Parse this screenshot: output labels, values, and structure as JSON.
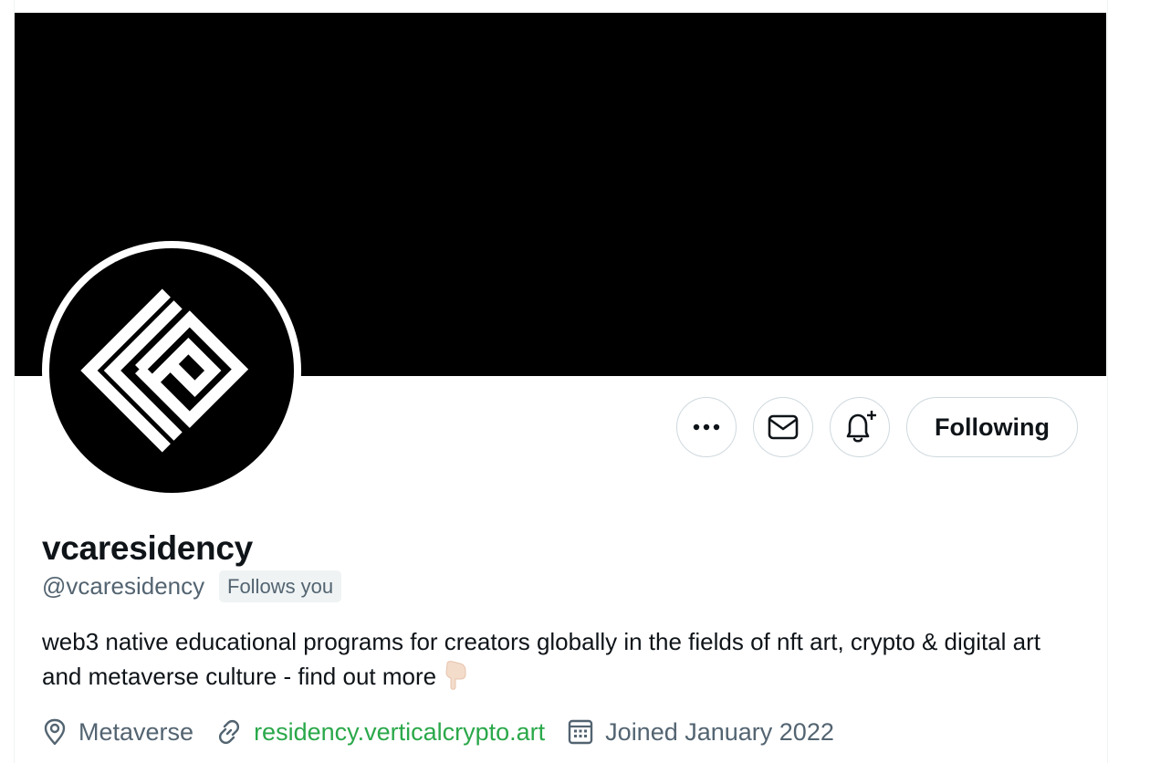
{
  "profile": {
    "display_name": "vcaresidency",
    "handle": "@vcaresidency",
    "follows_badge": "Follows you",
    "bio_text": "web3 native educational programs for creators globally in the fields of nft art, crypto & digital art and metaverse culture - find out more",
    "bio_emoji_icon": "pointing-down-hand-icon",
    "location": "Metaverse",
    "website": "residency.verticalcrypto.art",
    "joined": "Joined January 2022"
  },
  "actions": {
    "following_label": "Following",
    "more_icon": "more-dots-icon",
    "message_icon": "envelope-icon",
    "notifications_icon": "bell-plus-icon"
  },
  "colors": {
    "banner": "#000000",
    "link": "#2aa84a",
    "secondary_text": "#536471",
    "primary_text": "#0f1419",
    "border": "#cfd9de"
  }
}
